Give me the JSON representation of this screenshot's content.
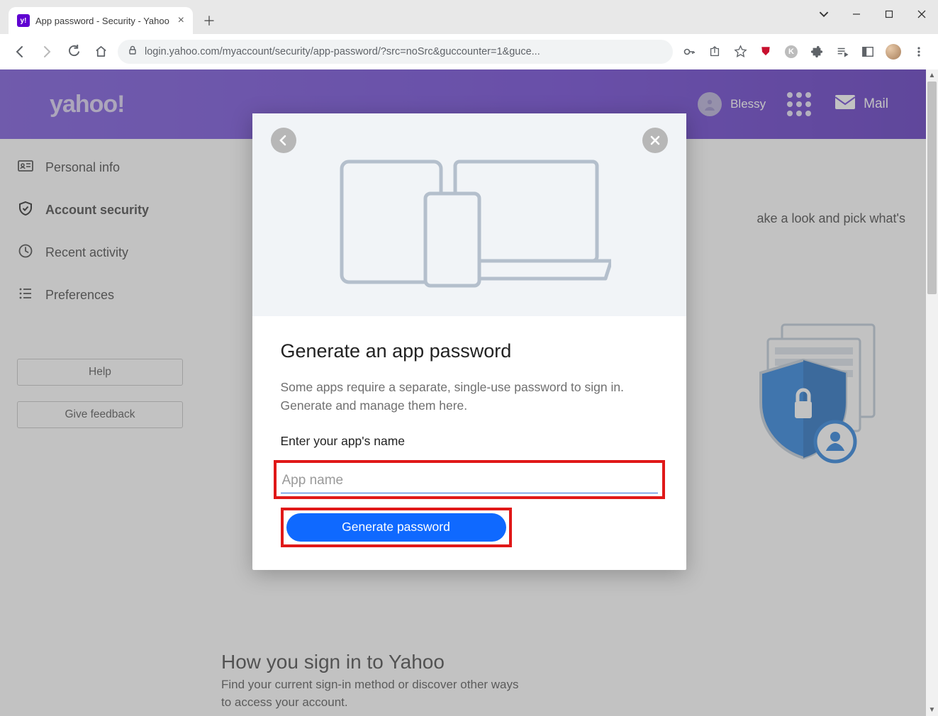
{
  "browser": {
    "tab_title": "App password - Security - Yahoo",
    "url": "login.yahoo.com/myaccount/security/app-password/?src=noSrc&guccounter=1&guce..."
  },
  "header": {
    "brand": "yahoo!",
    "username": "Blessy",
    "mail_label": "Mail"
  },
  "sidebar": {
    "items": [
      {
        "label": "Personal info"
      },
      {
        "label": "Account security"
      },
      {
        "label": "Recent activity"
      },
      {
        "label": "Preferences"
      }
    ],
    "help_label": "Help",
    "feedback_label": "Give feedback"
  },
  "background_page": {
    "peek_text": "ake a look and pick what's",
    "signin_heading": "How you sign in to Yahoo",
    "signin_desc": "Find your current sign-in method or discover other ways to access your account."
  },
  "modal": {
    "title": "Generate an app password",
    "description": "Some apps require a separate, single-use password to sign in. Generate and manage them here.",
    "field_label": "Enter your app's name",
    "placeholder": "App name",
    "button_label": "Generate password"
  }
}
